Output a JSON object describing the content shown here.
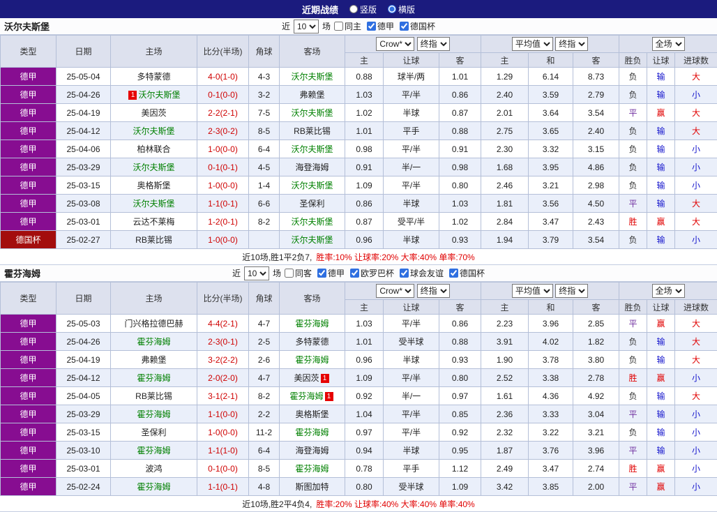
{
  "topbar": {
    "title": "近期战绩",
    "layout_options": [
      {
        "label": "竖版",
        "selected": false
      },
      {
        "label": "横版",
        "selected": true
      }
    ]
  },
  "table_header": {
    "col_type": "类型",
    "col_date": "日期",
    "col_home": "主场",
    "col_score": "比分(半场)",
    "col_corner": "角球",
    "col_away": "客场",
    "sub": [
      "主",
      "让球",
      "客",
      "主",
      "和",
      "客",
      "胜负",
      "让球",
      "进球数"
    ]
  },
  "colors": {
    "topbar_bg": "#1b1b7e",
    "league_purple": "#870d91",
    "league_red": "#a30d0d",
    "focus_team": "#008000",
    "score_red": "#cf0000",
    "result_win": "#e00000",
    "result_lose_handicap": "#1414cc",
    "result_draw": "#7030a0"
  },
  "sections": [
    {
      "team": "沃尔夫斯堡",
      "filter": {
        "prefix": "近",
        "count": "10",
        "suffix": "场",
        "checkboxes": [
          {
            "label": "同主",
            "checked": false
          },
          {
            "label": "德甲",
            "checked": true
          },
          {
            "label": "德国杯",
            "checked": true
          }
        ]
      },
      "selects": {
        "company": "Crow*",
        "company_stage": "终指",
        "average": "平均值",
        "average_stage": "终指",
        "scope": "全场"
      },
      "rows": [
        {
          "league": "德甲",
          "date": "25-05-04",
          "home": "多特蒙德",
          "home_focus": false,
          "score": "4-0(1-0)",
          "corner": "4-3",
          "away": "沃尔夫斯堡",
          "away_focus": true,
          "asia": [
            "0.88",
            "球半/两",
            "1.01"
          ],
          "euro": [
            "1.29",
            "6.14",
            "8.73"
          ],
          "results": [
            "负",
            "输",
            "大"
          ]
        },
        {
          "league": "德甲",
          "date": "25-04-26",
          "home": "沃尔夫斯堡",
          "home_focus": true,
          "home_badge": "1",
          "home_badge_pos": "before",
          "score": "0-1(0-0)",
          "corner": "3-2",
          "away": "弗赖堡",
          "away_focus": false,
          "asia": [
            "1.03",
            "平/半",
            "0.86"
          ],
          "euro": [
            "2.40",
            "3.59",
            "2.79"
          ],
          "results": [
            "负",
            "输",
            "小"
          ]
        },
        {
          "league": "德甲",
          "date": "25-04-19",
          "home": "美因茨",
          "home_focus": false,
          "score": "2-2(2-1)",
          "corner": "7-5",
          "away": "沃尔夫斯堡",
          "away_focus": true,
          "asia": [
            "1.02",
            "半球",
            "0.87"
          ],
          "euro": [
            "2.01",
            "3.64",
            "3.54"
          ],
          "results": [
            "平",
            "赢",
            "大"
          ]
        },
        {
          "league": "德甲",
          "date": "25-04-12",
          "home": "沃尔夫斯堡",
          "home_focus": true,
          "score": "2-3(0-2)",
          "corner": "8-5",
          "away": "RB莱比锡",
          "away_focus": false,
          "asia": [
            "1.01",
            "平手",
            "0.88"
          ],
          "euro": [
            "2.75",
            "3.65",
            "2.40"
          ],
          "results": [
            "负",
            "输",
            "大"
          ]
        },
        {
          "league": "德甲",
          "date": "25-04-06",
          "home": "柏林联合",
          "home_focus": false,
          "score": "1-0(0-0)",
          "corner": "6-4",
          "away": "沃尔夫斯堡",
          "away_focus": true,
          "asia": [
            "0.98",
            "平/半",
            "0.91"
          ],
          "euro": [
            "2.30",
            "3.32",
            "3.15"
          ],
          "results": [
            "负",
            "输",
            "小"
          ]
        },
        {
          "league": "德甲",
          "date": "25-03-29",
          "home": "沃尔夫斯堡",
          "home_focus": true,
          "score": "0-1(0-1)",
          "corner": "4-5",
          "away": "海登海姆",
          "away_focus": false,
          "asia": [
            "0.91",
            "半/一",
            "0.98"
          ],
          "euro": [
            "1.68",
            "3.95",
            "4.86"
          ],
          "results": [
            "负",
            "输",
            "小"
          ]
        },
        {
          "league": "德甲",
          "date": "25-03-15",
          "home": "奥格斯堡",
          "home_focus": false,
          "score": "1-0(0-0)",
          "corner": "1-4",
          "away": "沃尔夫斯堡",
          "away_focus": true,
          "asia": [
            "1.09",
            "平/半",
            "0.80"
          ],
          "euro": [
            "2.46",
            "3.21",
            "2.98"
          ],
          "results": [
            "负",
            "输",
            "小"
          ]
        },
        {
          "league": "德甲",
          "date": "25-03-08",
          "home": "沃尔夫斯堡",
          "home_focus": true,
          "score": "1-1(0-1)",
          "corner": "6-6",
          "away": "圣保利",
          "away_focus": false,
          "asia": [
            "0.86",
            "半球",
            "1.03"
          ],
          "euro": [
            "1.81",
            "3.56",
            "4.50"
          ],
          "results": [
            "平",
            "输",
            "大"
          ]
        },
        {
          "league": "德甲",
          "date": "25-03-01",
          "home": "云达不莱梅",
          "home_focus": false,
          "score": "1-2(0-1)",
          "corner": "8-2",
          "away": "沃尔夫斯堡",
          "away_focus": true,
          "asia": [
            "0.87",
            "受平/半",
            "1.02"
          ],
          "euro": [
            "2.84",
            "3.47",
            "2.43"
          ],
          "results": [
            "胜",
            "赢",
            "大"
          ]
        },
        {
          "league": "德国杯",
          "date": "25-02-27",
          "home": "RB莱比锡",
          "home_focus": false,
          "score": "1-0(0-0)",
          "corner": "",
          "away": "沃尔夫斯堡",
          "away_focus": true,
          "asia": [
            "0.96",
            "半球",
            "0.93"
          ],
          "euro": [
            "1.94",
            "3.79",
            "3.54"
          ],
          "results": [
            "负",
            "输",
            "小"
          ]
        }
      ],
      "summary": {
        "plain": "近10场,胜1平2负7,",
        "highlight": "胜率:10% 让球率:20% 大率:40% 单率:70%"
      }
    },
    {
      "team": "霍芬海姆",
      "filter": {
        "prefix": "近",
        "count": "10",
        "suffix": "场",
        "checkboxes": [
          {
            "label": "同客",
            "checked": false
          },
          {
            "label": "德甲",
            "checked": true
          },
          {
            "label": "欧罗巴杯",
            "checked": true
          },
          {
            "label": "球会友谊",
            "checked": true
          },
          {
            "label": "德国杯",
            "checked": true
          }
        ]
      },
      "selects": {
        "company": "Crow*",
        "company_stage": "终指",
        "average": "平均值",
        "average_stage": "终指",
        "scope": "全场"
      },
      "rows": [
        {
          "league": "德甲",
          "date": "25-05-03",
          "home": "门兴格拉德巴赫",
          "home_focus": false,
          "score": "4-4(2-1)",
          "corner": "4-7",
          "away": "霍芬海姆",
          "away_focus": true,
          "asia": [
            "1.03",
            "平/半",
            "0.86"
          ],
          "euro": [
            "2.23",
            "3.96",
            "2.85"
          ],
          "results": [
            "平",
            "赢",
            "大"
          ]
        },
        {
          "league": "德甲",
          "date": "25-04-26",
          "home": "霍芬海姆",
          "home_focus": true,
          "score": "2-3(0-1)",
          "corner": "2-5",
          "away": "多特蒙德",
          "away_focus": false,
          "asia": [
            "1.01",
            "受半球",
            "0.88"
          ],
          "euro": [
            "3.91",
            "4.02",
            "1.82"
          ],
          "results": [
            "负",
            "输",
            "大"
          ]
        },
        {
          "league": "德甲",
          "date": "25-04-19",
          "home": "弗赖堡",
          "home_focus": false,
          "score": "3-2(2-2)",
          "corner": "2-6",
          "away": "霍芬海姆",
          "away_focus": true,
          "asia": [
            "0.96",
            "半球",
            "0.93"
          ],
          "euro": [
            "1.90",
            "3.78",
            "3.80"
          ],
          "results": [
            "负",
            "输",
            "大"
          ]
        },
        {
          "league": "德甲",
          "date": "25-04-12",
          "home": "霍芬海姆",
          "home_focus": true,
          "score": "2-0(2-0)",
          "corner": "4-7",
          "away": "美因茨",
          "away_focus": false,
          "away_badge": "1",
          "away_badge_pos": "after",
          "asia": [
            "1.09",
            "平/半",
            "0.80"
          ],
          "euro": [
            "2.52",
            "3.38",
            "2.78"
          ],
          "results": [
            "胜",
            "赢",
            "小"
          ]
        },
        {
          "league": "德甲",
          "date": "25-04-05",
          "home": "RB莱比锡",
          "home_focus": false,
          "score": "3-1(2-1)",
          "corner": "8-2",
          "away": "霍芬海姆",
          "away_focus": true,
          "away_badge": "1",
          "away_badge_pos": "after",
          "asia": [
            "0.92",
            "半/一",
            "0.97"
          ],
          "euro": [
            "1.61",
            "4.36",
            "4.92"
          ],
          "results": [
            "负",
            "输",
            "大"
          ]
        },
        {
          "league": "德甲",
          "date": "25-03-29",
          "home": "霍芬海姆",
          "home_focus": true,
          "score": "1-1(0-0)",
          "corner": "2-2",
          "away": "奥格斯堡",
          "away_focus": false,
          "asia": [
            "1.04",
            "平/半",
            "0.85"
          ],
          "euro": [
            "2.36",
            "3.33",
            "3.04"
          ],
          "results": [
            "平",
            "输",
            "小"
          ]
        },
        {
          "league": "德甲",
          "date": "25-03-15",
          "home": "圣保利",
          "home_focus": false,
          "score": "1-0(0-0)",
          "corner": "11-2",
          "away": "霍芬海姆",
          "away_focus": true,
          "asia": [
            "0.97",
            "平/半",
            "0.92"
          ],
          "euro": [
            "2.32",
            "3.22",
            "3.21"
          ],
          "results": [
            "负",
            "输",
            "小"
          ]
        },
        {
          "league": "德甲",
          "date": "25-03-10",
          "home": "霍芬海姆",
          "home_focus": true,
          "score": "1-1(1-0)",
          "corner": "6-4",
          "away": "海登海姆",
          "away_focus": false,
          "asia": [
            "0.94",
            "半球",
            "0.95"
          ],
          "euro": [
            "1.87",
            "3.76",
            "3.96"
          ],
          "results": [
            "平",
            "输",
            "小"
          ]
        },
        {
          "league": "德甲",
          "date": "25-03-01",
          "home": "波鸿",
          "home_focus": false,
          "score": "0-1(0-0)",
          "corner": "8-5",
          "away": "霍芬海姆",
          "away_focus": true,
          "asia": [
            "0.78",
            "平手",
            "1.12"
          ],
          "euro": [
            "2.49",
            "3.47",
            "2.74"
          ],
          "results": [
            "胜",
            "赢",
            "小"
          ]
        },
        {
          "league": "德甲",
          "date": "25-02-24",
          "home": "霍芬海姆",
          "home_focus": true,
          "score": "1-1(0-1)",
          "corner": "4-8",
          "away": "斯图加特",
          "away_focus": false,
          "asia": [
            "0.80",
            "受半球",
            "1.09"
          ],
          "euro": [
            "3.42",
            "3.85",
            "2.00"
          ],
          "results": [
            "平",
            "赢",
            "小"
          ]
        }
      ],
      "summary": {
        "plain": "近10场,胜2平4负4,",
        "highlight": "胜率:20% 让球率:40% 大率:40% 单率:40%"
      }
    }
  ]
}
